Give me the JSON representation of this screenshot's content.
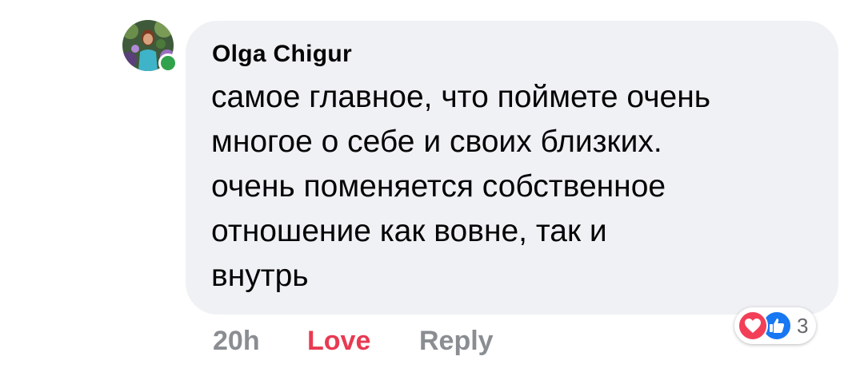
{
  "comment": {
    "author": "Olga  Chigur",
    "text": "самое главное, что поймете очень\nмногое о себе и своих близких.\nочень поменяется собственное\nотношение как вовне, так и\nвнутрь",
    "online": true
  },
  "actions": {
    "time": "20h",
    "love_label": "Love",
    "reply_label": "Reply"
  },
  "reactions": {
    "icons": [
      "heart-icon",
      "thumbs-up-icon"
    ],
    "count": "3"
  },
  "colors": {
    "love_accent": "#e83a52",
    "like_blue": "#1877f2",
    "bubble_bg": "#f0f1f5",
    "online_green": "#31a24c"
  }
}
